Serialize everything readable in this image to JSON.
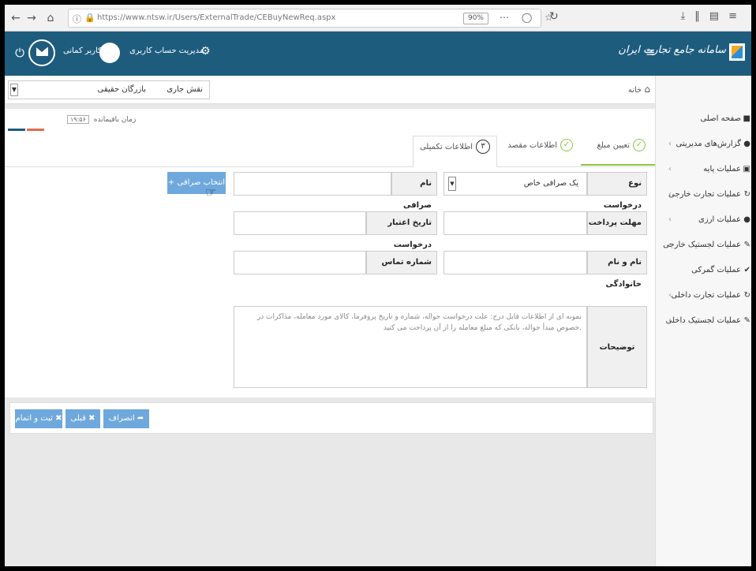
{
  "browser": {
    "url": "https://www.ntsw.ir/Users/ExternalTrade/CEBuyNewReq.aspx",
    "zoom": "90%",
    "back_icon": "back-arrow",
    "forward_icon": "forward-arrow",
    "home_icon": "home",
    "reload_icon": "reload",
    "download_icon": "download-arrow",
    "library_icon": "library",
    "sidebar_icon": "sidebar",
    "menu_icon": "menu"
  },
  "header": {
    "brand": "سامانه جامع تجارت ایران",
    "user_label": "کاربر کمانی",
    "account_label": "مدیریت حساب کاربری",
    "power_icon": "power-icon",
    "mail_icon": "mail-icon",
    "gear_icon": "gear-icon",
    "color": "#1e5c7e"
  },
  "toolbar": {
    "role_caption": "نقش جاری",
    "role_value": "بازرگان حقیقی",
    "breadcrumb": "خانه",
    "remaining_label": "زمان باقیمانده",
    "remaining_value": "۱۹:۵۶"
  },
  "steps": [
    {
      "label": "تعیین مبلغ",
      "state": "done"
    },
    {
      "label": "اطلاعات مقصد",
      "state": "done"
    },
    {
      "label": "اطلاعات تکمیلی",
      "state": "active",
      "number": "۳"
    }
  ],
  "form": {
    "request_type_label": "نوع درخواست",
    "request_type_value": "یک صرافی خاص",
    "exchange_name_label": "نام صرافی",
    "add_exchange_button": "انتخاب صرافی",
    "payment_deadline_label": "مهلت پرداخت",
    "request_validity_label": "تاریخ اعتبار درخواست",
    "fullname_label": "نام و نام خانوادگی",
    "contact_number_label": "شماره تماس",
    "description_label": "توضیحات",
    "description_text": "نمونه ای از اطلاعات قابل درج: علت درخواست حواله، شماره و تاریخ پروفرما، کالای مورد معامله، مذاکرات در خصوص مبدأ حواله، بانکی که مبلغ معامله را از آن پرداخت می کنید."
  },
  "actions": {
    "cancel": "انصراف",
    "previous": "قبلی",
    "submit": "ثبت و اتمام"
  },
  "sidebar": {
    "items": [
      {
        "label": "صفحه اصلی",
        "icon": "home-icon",
        "has_children": false
      },
      {
        "label": "گزارش‌های مدیریتی",
        "icon": "user-icon",
        "has_children": true
      },
      {
        "label": "عملیات پایه",
        "icon": "chart-icon",
        "has_children": true
      },
      {
        "label": "عملیات تجارت خارجی",
        "icon": "refresh-icon",
        "has_children": true
      },
      {
        "label": "عملیات ارزی",
        "icon": "money-icon",
        "has_children": true
      },
      {
        "label": "عملیات لجستیک خارجی",
        "icon": "edit-icon",
        "has_children": true
      },
      {
        "label": "عملیات گمرکی",
        "icon": "check-icon",
        "has_children": true
      },
      {
        "label": "عملیات تجارت داخلی",
        "icon": "refresh-icon",
        "has_children": true
      },
      {
        "label": "عملیات لجستیک داخلی",
        "icon": "edit-icon",
        "has_children": true
      }
    ]
  }
}
